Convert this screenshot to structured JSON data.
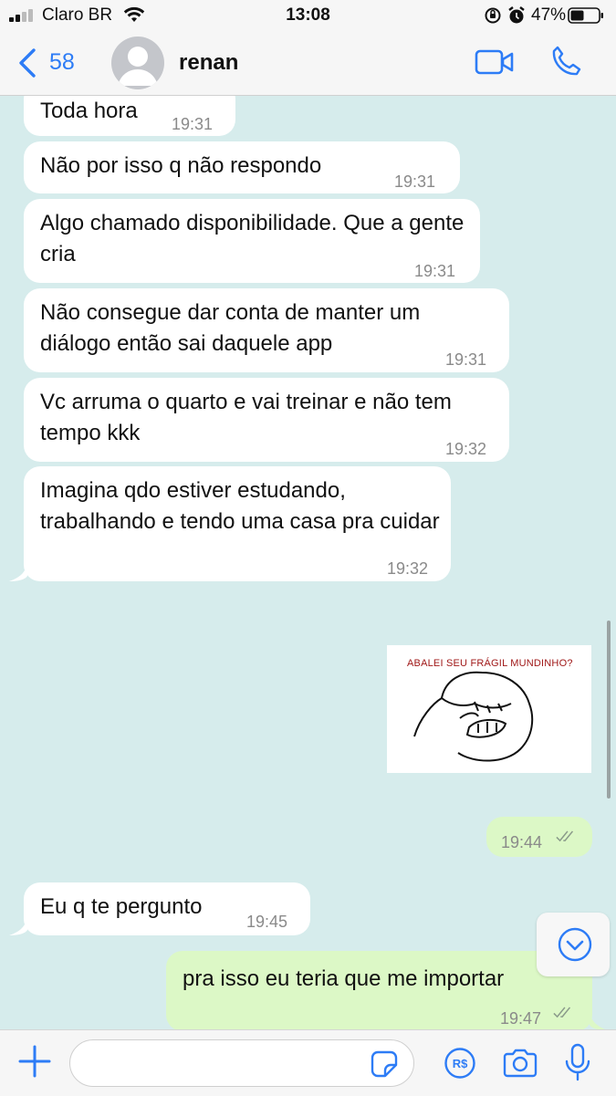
{
  "status_bar": {
    "carrier": "Claro BR",
    "time": "13:08",
    "battery_percent": "47%",
    "battery_level": 0.47
  },
  "header": {
    "back_count": "58",
    "contact_name": "renan",
    "icons": [
      "chevron-left-icon",
      "avatar-icon",
      "video-call-icon",
      "phone-icon"
    ]
  },
  "messages": [
    {
      "direction": "in",
      "text": "Toda hora",
      "time": "19:31"
    },
    {
      "direction": "in",
      "text": "Não por isso q não respondo",
      "time": "19:31"
    },
    {
      "direction": "in",
      "text": "Algo chamado disponibilidade. Que a gente cria",
      "time": "19:31"
    },
    {
      "direction": "in",
      "text": "Não consegue dar conta de manter um diálogo então sai daquele app",
      "time": "19:31"
    },
    {
      "direction": "in",
      "text": "Vc arruma o quarto e vai treinar e não tem tempo kkk",
      "time": "19:32"
    },
    {
      "direction": "in",
      "text": "Imagina qdo estiver estudando, trabalhando e tendo uma casa pra cuidar",
      "time": "19:32"
    },
    {
      "direction": "out",
      "type": "sticker",
      "caption": "ABALEI SEU FRÁGIL MUNDINHO?"
    },
    {
      "direction": "out",
      "text": "",
      "time": "19:44",
      "read": true
    },
    {
      "direction": "in",
      "text": "Eu q te pergunto",
      "time": "19:45"
    },
    {
      "direction": "out",
      "text": "pra isso eu teria que me importar",
      "time": "19:47",
      "read": true
    }
  ],
  "input": {
    "value": "",
    "icons": [
      "plus-icon",
      "sticker-icon",
      "payment-icon",
      "camera-icon",
      "microphone-icon"
    ]
  },
  "colors": {
    "chat_background": "#d6ecec",
    "incoming_bubble": "#ffffff",
    "outgoing_bubble": "#dcf8c6",
    "accent": "#2d7cf6"
  }
}
